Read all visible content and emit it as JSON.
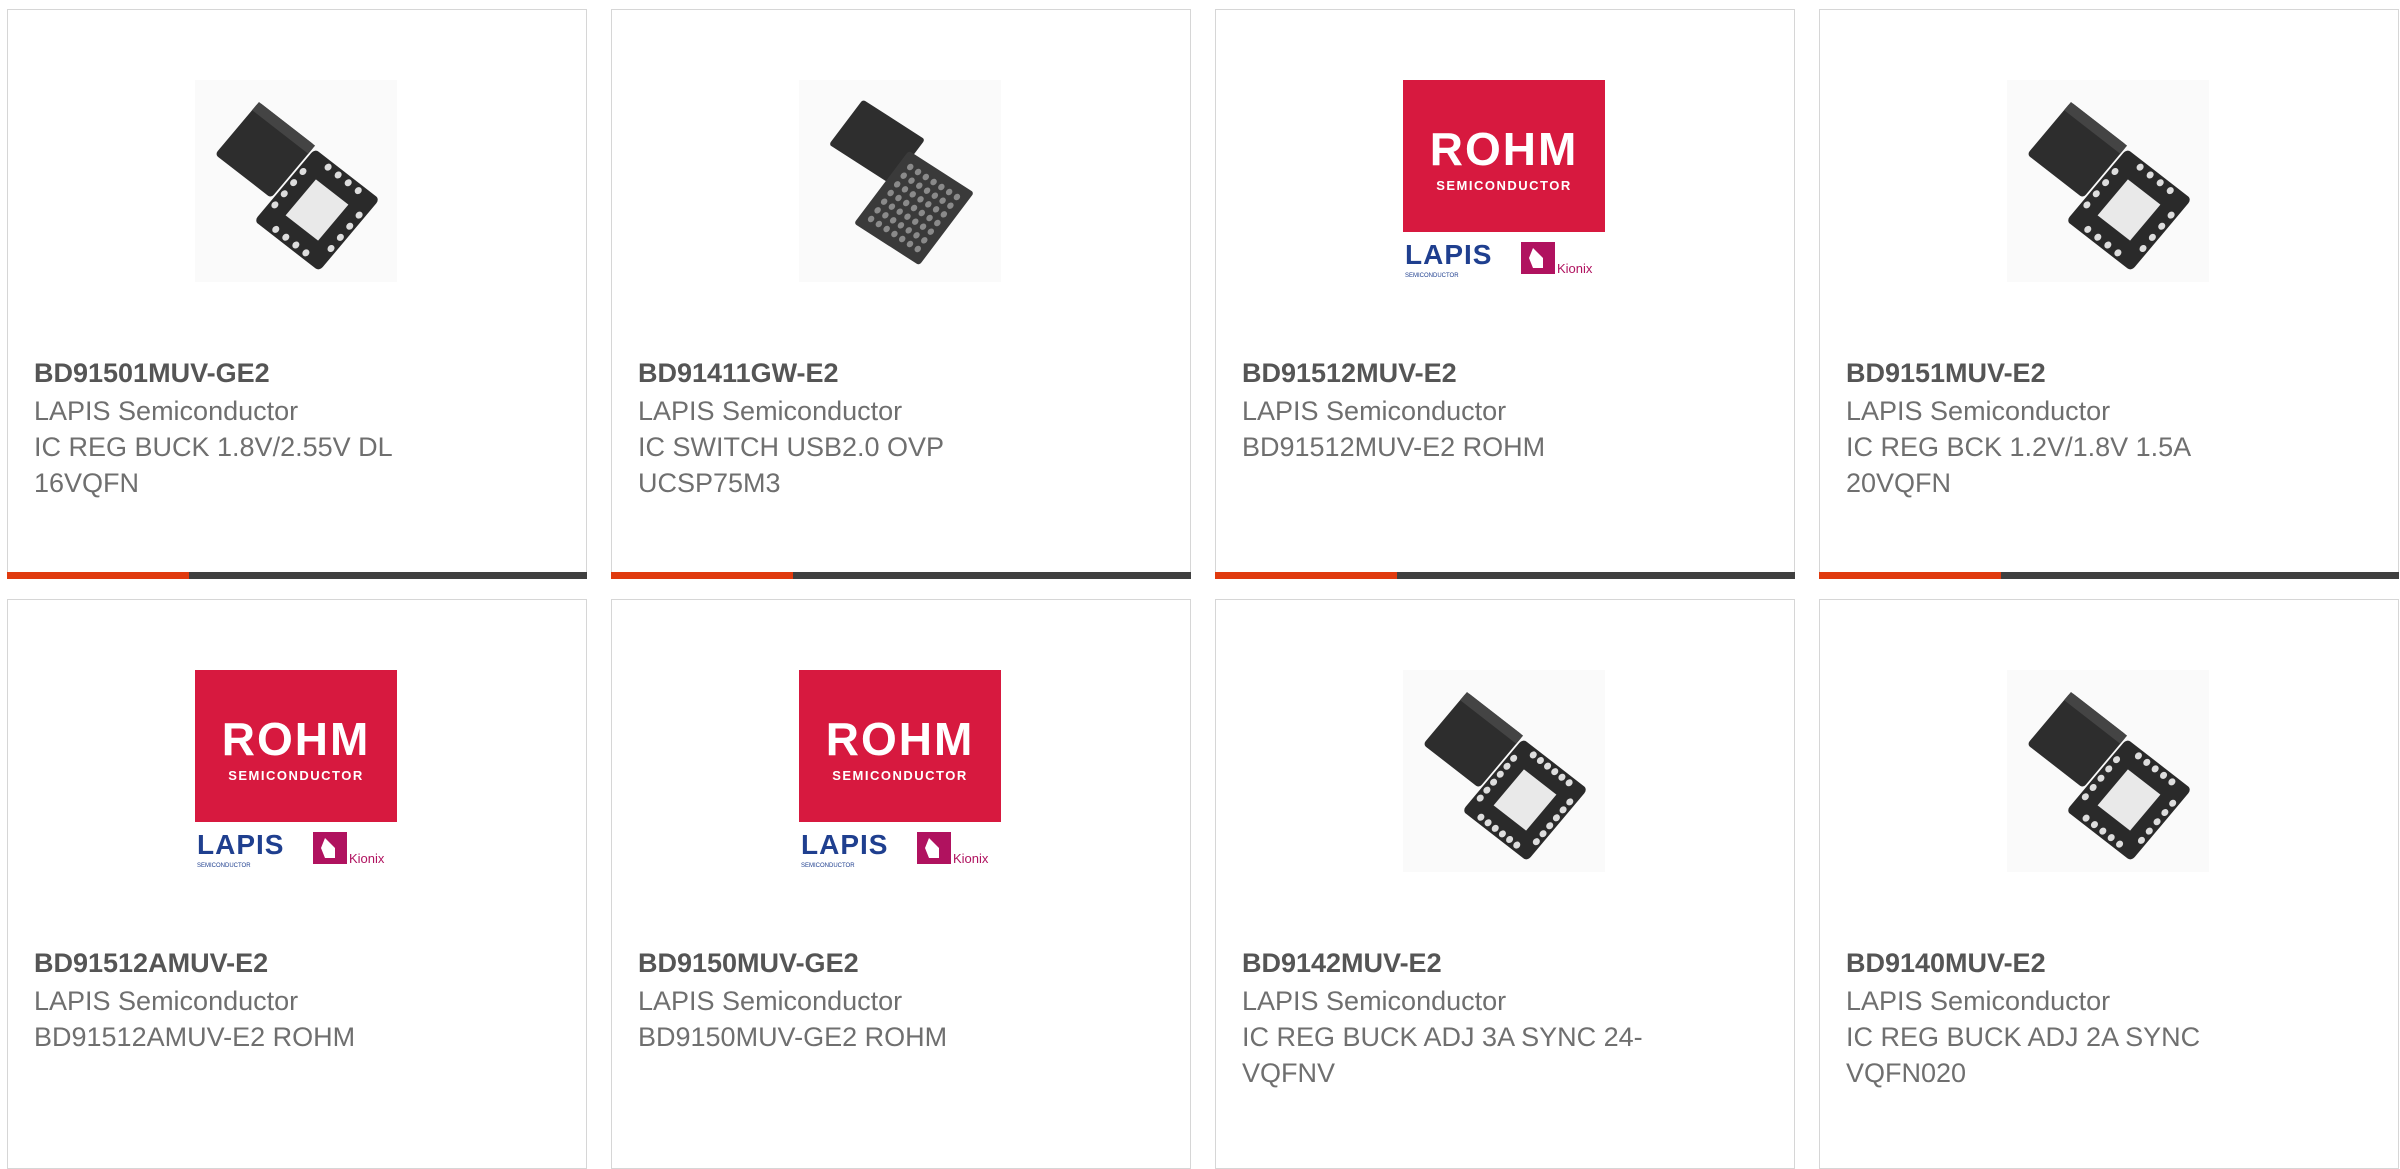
{
  "products": [
    {
      "part_number": "BD91501MUV-GE2",
      "manufacturer": "LAPIS Semiconductor",
      "description": "IC REG BUCK 1.8V/2.55V DL 16VQFN",
      "image": "qfn-16-chip-icon"
    },
    {
      "part_number": "BD91411GW-E2",
      "manufacturer": "LAPIS Semiconductor",
      "description": "IC SWITCH USB2.0 OVP UCSP75M3",
      "image": "bga-chip-icon"
    },
    {
      "part_number": "BD91512MUV-E2",
      "manufacturer": "LAPIS Semiconductor",
      "description": "BD91512MUV-E2 ROHM",
      "image": "rohm-logo",
      "logo": {
        "brand": "ROHM",
        "sub": "SEMICONDUCTOR",
        "lapis": "LAPIS",
        "lapis_sub": "SEMICONDUCTOR",
        "kionix": "Kionix"
      }
    },
    {
      "part_number": "BD9151MUV-E2",
      "manufacturer": "LAPIS Semiconductor",
      "description": "IC REG BCK 1.2V/1.8V 1.5A 20VQFN",
      "image": "qfn-16-chip-icon"
    },
    {
      "part_number": "BD91512AMUV-E2",
      "manufacturer": "LAPIS Semiconductor",
      "description": "BD91512AMUV-E2 ROHM",
      "image": "rohm-logo",
      "logo": {
        "brand": "ROHM",
        "sub": "SEMICONDUCTOR",
        "lapis": "LAPIS",
        "lapis_sub": "SEMICONDUCTOR",
        "kionix": "Kionix"
      }
    },
    {
      "part_number": "BD9150MUV-GE2",
      "manufacturer": "LAPIS Semiconductor",
      "description": "BD9150MUV-GE2 ROHM",
      "image": "rohm-logo",
      "logo": {
        "brand": "ROHM",
        "sub": "SEMICONDUCTOR",
        "lapis": "LAPIS",
        "lapis_sub": "SEMICONDUCTOR",
        "kionix": "Kionix"
      }
    },
    {
      "part_number": "BD9142MUV-E2",
      "manufacturer": "LAPIS Semiconductor",
      "description": "IC REG BUCK ADJ 3A SYNC 24-VQFNV",
      "image": "qfn-24-chip-icon"
    },
    {
      "part_number": "BD9140MUV-E2",
      "manufacturer": "LAPIS Semiconductor",
      "description": "IC REG BUCK ADJ 2A SYNC VQFN020",
      "image": "qfn-20-chip-icon"
    }
  ],
  "colors": {
    "accent": "#e03a0e",
    "bar": "#3f3f3f",
    "rohm_red": "#d7193f",
    "lapis_blue": "#1f3f8f",
    "kionix_magenta": "#b0125f"
  }
}
